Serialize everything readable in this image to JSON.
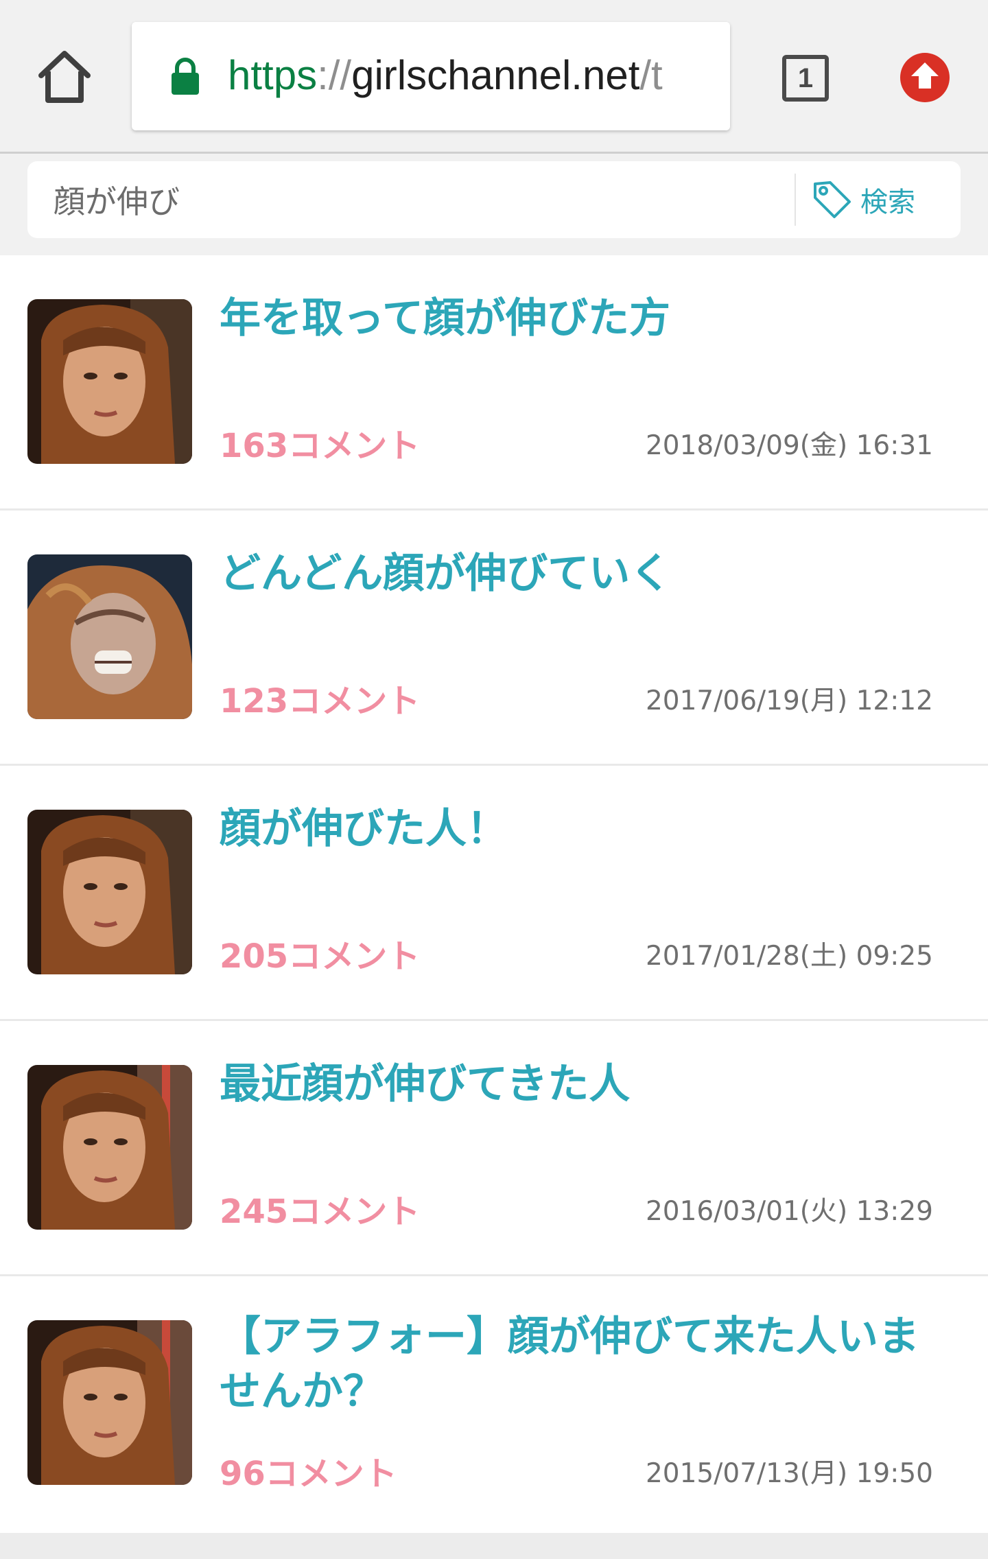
{
  "browser": {
    "url_scheme": "https",
    "url_sep": "://",
    "url_host": "girlschannel.net",
    "url_path": "/t",
    "tab_count": "1",
    "colors": {
      "secure": "#0b8043",
      "extension": "#d93025"
    },
    "icons": [
      "home-icon",
      "lock-icon",
      "tab-switcher-icon",
      "upload-arrow-icon"
    ]
  },
  "search": {
    "query": "顔が伸び",
    "button_label": "検索",
    "button_icon": "tag-icon"
  },
  "colors": {
    "title": "#2ca6b8",
    "comments": "#f18ea1",
    "date": "#6f6f6f"
  },
  "topics": [
    {
      "title": "年を取って顔が伸びた方",
      "comments": "163コメント",
      "date": "2018/03/09(金) 16:31"
    },
    {
      "title": "どんどん顔が伸びていく",
      "comments": "123コメント",
      "date": "2017/06/19(月) 12:12"
    },
    {
      "title": "顔が伸びた人！",
      "comments": "205コメント",
      "date": "2017/01/28(土) 09:25"
    },
    {
      "title": "最近顔が伸びてきた人",
      "comments": "245コメント",
      "date": "2016/03/01(火) 13:29"
    },
    {
      "title": "【アラフォー】顔が伸びて来た人いませんか？",
      "comments": "96コメント",
      "date": "2015/07/13(月) 19:50"
    }
  ]
}
